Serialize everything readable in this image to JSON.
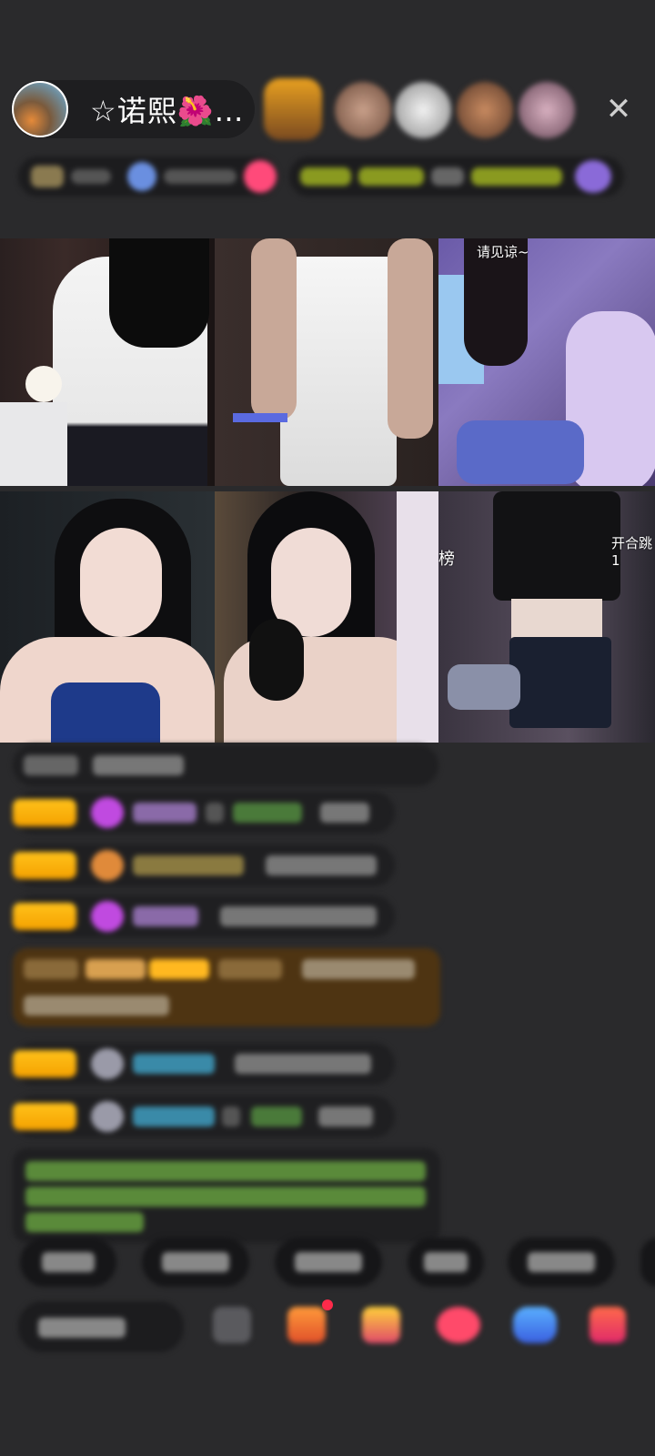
{
  "header": {
    "host_name": "☆诺熙🌺…",
    "close_icon": "✕"
  },
  "video_grid": {
    "tiles": [
      {
        "label": ""
      },
      {
        "label": ""
      },
      {
        "label": "请见谅~"
      },
      {
        "label": ""
      },
      {
        "label": ""
      },
      {
        "label": "开合跳1"
      }
    ],
    "side_label": "榜"
  },
  "colors": {
    "background": "#2a2a2c",
    "badge_gold": "#ffc21a",
    "chat_bg": "#1f1f21",
    "highlight_brown": "#5a3a12",
    "green_text": "#7bd36a",
    "cyan_name": "#4fc3e8",
    "purple_name": "#b07ad8"
  },
  "icons": [
    "close-icon",
    "gift-icon",
    "box-icon",
    "fan-icon",
    "chat-icon",
    "game-icon",
    "more-icon"
  ]
}
